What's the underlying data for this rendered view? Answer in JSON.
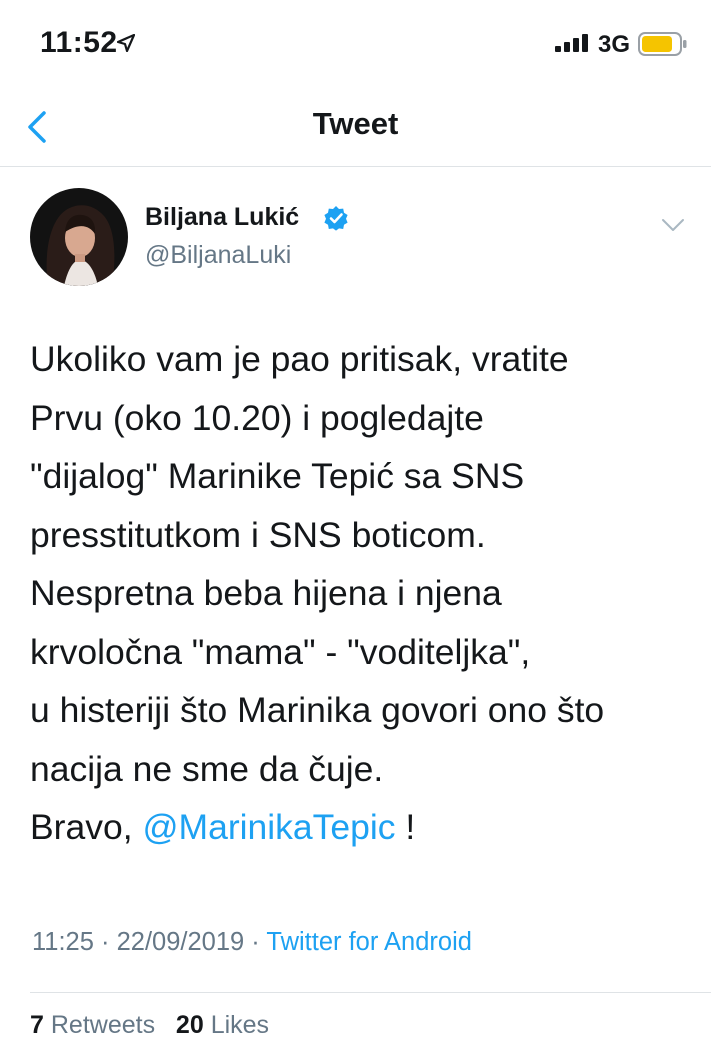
{
  "status_bar": {
    "time": "11:52",
    "network": "3G"
  },
  "nav": {
    "title": "Tweet"
  },
  "tweet": {
    "author_name": "Biljana Lukić",
    "author_handle": "@BiljanaLuki",
    "lines": [
      "Ukoliko vam je pao pritisak, vratite",
      "Prvu (oko 10.20) i pogledajte",
      "\"dijalog\" Marinike Tepić sa SNS",
      "presstitutkom i SNS boticom.",
      "Nespretna beba hijena i njena",
      "krvoločna \"mama\" - \"voditeljka\",",
      "u histeriji što Marinika govori ono što",
      "nacija ne sme da čuje."
    ],
    "last_line_prefix": "Bravo, ",
    "mention": "@MarinikaTepic",
    "last_line_suffix": " !",
    "time": "11:25",
    "separator": " · ",
    "date": "22/09/2019",
    "source": "Twitter for Android"
  },
  "stats": {
    "retweets_count": "7",
    "retweets_label": "Retweets",
    "likes_count": "20",
    "likes_label": "Likes"
  },
  "colors": {
    "accent": "#1da1f2",
    "secondary_text": "#657786",
    "battery": "#f5c400"
  },
  "icons": [
    "location-arrow-icon",
    "signal-bars-icon",
    "battery-icon",
    "back-chevron-icon",
    "verified-badge-icon",
    "chevron-down-icon"
  ]
}
